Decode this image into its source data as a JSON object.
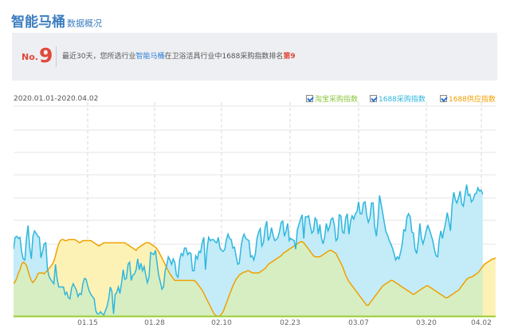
{
  "header": {
    "title": "智能马桶",
    "subtitle": "数据概况"
  },
  "rank": {
    "prefix": "No.",
    "number": "9",
    "text_1": "最近30天，您所选行业",
    "text_highlight": "智能马桶",
    "text_2": "在卫浴洁具行业中1688采购指数排名",
    "text_rank": "第9"
  },
  "chart_data": {
    "type": "area",
    "date_range": "2020.01.01-2020.04.02",
    "x_labels": [
      "01.15",
      "01.28",
      "02.10",
      "02.23",
      "03.07",
      "03.20",
      "04.02"
    ],
    "ylim": [
      0,
      100
    ],
    "grid": true,
    "legend_position": "top-right",
    "series": [
      {
        "name": "淘宝采购指数",
        "color": "#9acd32",
        "fill": "#d7eec2",
        "values": []
      },
      {
        "name": "1688采购指数",
        "color": "#2eb6de",
        "fill": "#c3ecf8",
        "values": [
          62,
          73,
          74,
          72,
          73,
          60,
          53,
          52,
          72,
          84,
          64,
          53,
          74,
          79,
          77,
          74,
          73,
          54,
          60,
          67,
          68,
          44,
          37,
          34,
          32,
          30,
          48,
          35,
          27,
          27,
          27,
          27,
          20,
          22,
          17,
          16,
          26,
          30,
          27,
          24,
          18,
          21,
          20,
          30,
          35,
          34,
          28,
          23,
          20,
          18,
          16,
          5,
          2,
          2,
          4,
          2,
          1,
          5,
          9,
          16,
          27,
          23,
          2,
          20,
          22,
          27,
          21,
          31,
          43,
          34,
          35,
          48,
          50,
          33,
          38,
          39,
          43,
          53,
          43,
          49,
          42,
          46,
          38,
          31,
          36,
          59,
          58,
          57,
          61,
          49,
          38,
          32,
          25,
          27,
          42,
          47,
          55,
          52,
          48,
          53,
          50,
          38,
          36,
          52,
          58,
          56,
          63,
          63,
          57,
          59,
          58,
          42,
          42,
          56,
          53,
          60,
          59,
          68,
          73,
          43,
          62,
          73,
          70,
          71,
          71,
          69,
          68,
          73,
          63,
          61,
          60,
          62,
          71,
          76,
          72,
          71,
          63,
          64,
          56,
          48,
          49,
          63,
          72,
          76,
          72,
          71,
          70,
          55,
          56,
          52,
          58,
          72,
          78,
          81,
          65,
          68,
          82,
          88,
          70,
          74,
          82,
          75,
          70,
          71,
          73,
          79,
          87,
          88,
          74,
          79,
          86,
          70,
          72,
          71,
          70,
          62,
          80,
          85,
          90,
          94,
          72,
          92,
          92,
          93,
          84,
          77,
          79,
          91,
          89,
          76,
          85,
          72,
          67,
          74,
          86,
          79,
          83,
          90,
          91,
          84,
          70,
          72,
          94,
          93,
          78,
          77,
          91,
          95,
          76,
          88,
          93,
          90,
          95,
          97,
          106,
          95,
          95,
          105,
          106,
          94,
          87,
          91,
          105,
          105,
          83,
          74,
          89,
          112,
          104,
          95,
          86,
          78,
          75,
          70,
          67,
          63,
          58,
          52,
          55,
          53,
          59,
          66,
          80,
          79,
          92,
          95,
          92,
          78,
          77,
          62,
          58,
          69,
          86,
          72,
          67,
          73,
          80,
          84,
          80,
          75,
          70,
          62,
          56,
          55,
          71,
          79,
          72,
          80,
          87,
          96,
          88,
          79,
          103,
          115,
          108,
          105,
          110,
          116,
          104,
          102,
          113,
          122,
          112,
          113,
          106,
          108,
          113,
          114,
          119,
          116,
          117,
          113
        ]
      },
      {
        "name": "1688供应指数",
        "color": "#f0a000",
        "fill": "#fdf2b6",
        "values": [
          30,
          32,
          35,
          40,
          43,
          48,
          50,
          49,
          47,
          42,
          37,
          33,
          31,
          33,
          35,
          39,
          40,
          40,
          40,
          39,
          41,
          42,
          44,
          46,
          48,
          51,
          56,
          62,
          67,
          70,
          71,
          71,
          70,
          70,
          71,
          71,
          71,
          71,
          71,
          70,
          69,
          68,
          69,
          70,
          70,
          70,
          70,
          70,
          70,
          69,
          68,
          67,
          66,
          65,
          66,
          67,
          68,
          68,
          68,
          68,
          68,
          68,
          68,
          68,
          68,
          68,
          68,
          68,
          68,
          68,
          67,
          66,
          65,
          64,
          63,
          62,
          61,
          63,
          64,
          65,
          66,
          67,
          68,
          68,
          68,
          67,
          66,
          65,
          64,
          62,
          60,
          57,
          54,
          51,
          48,
          45,
          42,
          39,
          37,
          35,
          33,
          33,
          33,
          33,
          33,
          33,
          33,
          33,
          33,
          33,
          33,
          33,
          33,
          32,
          30,
          28,
          26,
          24,
          21,
          18,
          15,
          12,
          9,
          6,
          3,
          1,
          0,
          0,
          0,
          2,
          4,
          8,
          12,
          16,
          20,
          24,
          28,
          31,
          34,
          36,
          38,
          39,
          40,
          41,
          41,
          42,
          42,
          41,
          40,
          40,
          40,
          40,
          40,
          41,
          42,
          43,
          44,
          46,
          48,
          49,
          50,
          51,
          52,
          53,
          54,
          55,
          56,
          58,
          59,
          60,
          61,
          62,
          63,
          64,
          65,
          66,
          67,
          68,
          69,
          69,
          68,
          66,
          64,
          62,
          60,
          58,
          56,
          55,
          55,
          55,
          55,
          56,
          57,
          58,
          59,
          60,
          61,
          61,
          60,
          59,
          58,
          55,
          52,
          49,
          46,
          42,
          38,
          35,
          32,
          30,
          28,
          26,
          24,
          22,
          20,
          18,
          16,
          14,
          12,
          10,
          10,
          12,
          14,
          16,
          18,
          20,
          22,
          24,
          26,
          28,
          29,
          30,
          31,
          32,
          33,
          33,
          32,
          31,
          30,
          29,
          28,
          27,
          26,
          25,
          24,
          23,
          22,
          21,
          20,
          21,
          22,
          23,
          24,
          25,
          26,
          27,
          28,
          28,
          27,
          26,
          25,
          24,
          23,
          22,
          21,
          20,
          19,
          18,
          17,
          17,
          18,
          19,
          20,
          21,
          22,
          23,
          24,
          26,
          28,
          30,
          32,
          34,
          35,
          36,
          36,
          37,
          38,
          39,
          40,
          42,
          44,
          46,
          48,
          49,
          50,
          51,
          52,
          53,
          53,
          54,
          54,
          55,
          55,
          55,
          55
        ]
      }
    ]
  }
}
